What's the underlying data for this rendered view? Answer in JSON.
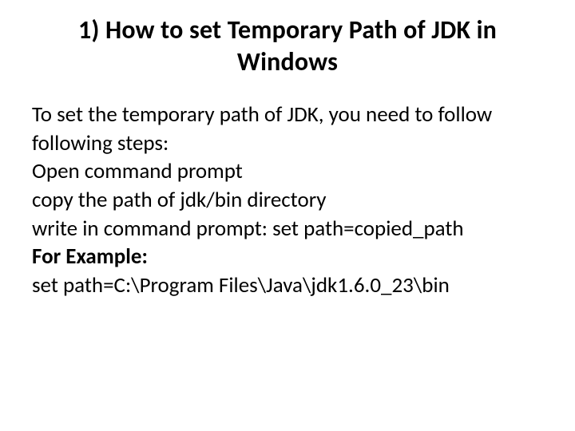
{
  "title": "1) How to set Temporary Path of JDK in Windows",
  "body": {
    "intro": "To set the temporary path of JDK, you need to follow following steps:",
    "step1": "Open command prompt",
    "step2": "copy the path of jdk/bin directory",
    "step3": "write in command prompt: set path=copied_path",
    "example_label": "For Example:",
    "example_cmd": "set path=C:\\Program Files\\Java\\jdk1.6.0_23\\bin"
  }
}
